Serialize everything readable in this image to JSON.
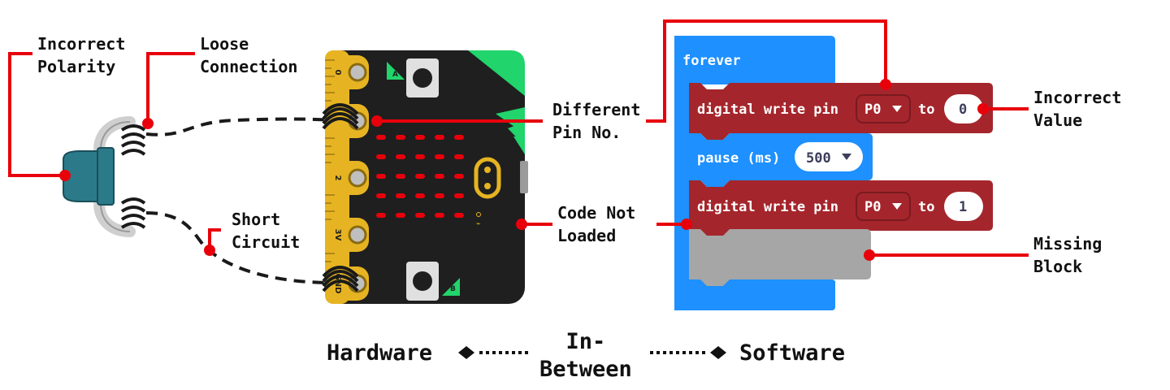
{
  "labels": {
    "incorrect_polarity": "Incorrect\nPolarity",
    "loose_connection": "Loose\nConnection",
    "short_circuit": "Short\nCircuit",
    "different_pin": "Different\nPin No.",
    "code_not_loaded": "Code Not\nLoaded",
    "incorrect_value": "Incorrect\nValue",
    "missing_block": "Missing\nBlock"
  },
  "spectrum": {
    "left": "Hardware",
    "middle": "In-\nBetween",
    "right": "Software"
  },
  "microbit": {
    "pins": [
      "0",
      "1",
      "2",
      "3V",
      "GND"
    ],
    "button_a": "A",
    "button_b": "B"
  },
  "code": {
    "forever": "forever",
    "write1": {
      "text": "digital write pin",
      "pin": "P0",
      "to": "to",
      "value": "0"
    },
    "pause": {
      "text": "pause (ms)",
      "value": "500"
    },
    "write2": {
      "text": "digital write pin",
      "pin": "P0",
      "to": "to",
      "value": "1"
    }
  },
  "colors": {
    "callout": "#e8000b",
    "block_blue": "#1e90ff",
    "block_red": "#a4262c",
    "block_gray": "#a6a6a6",
    "board": "#1f1f1f",
    "gold": "#e6b422",
    "led": "#e8000b",
    "green": "#21d46b"
  }
}
